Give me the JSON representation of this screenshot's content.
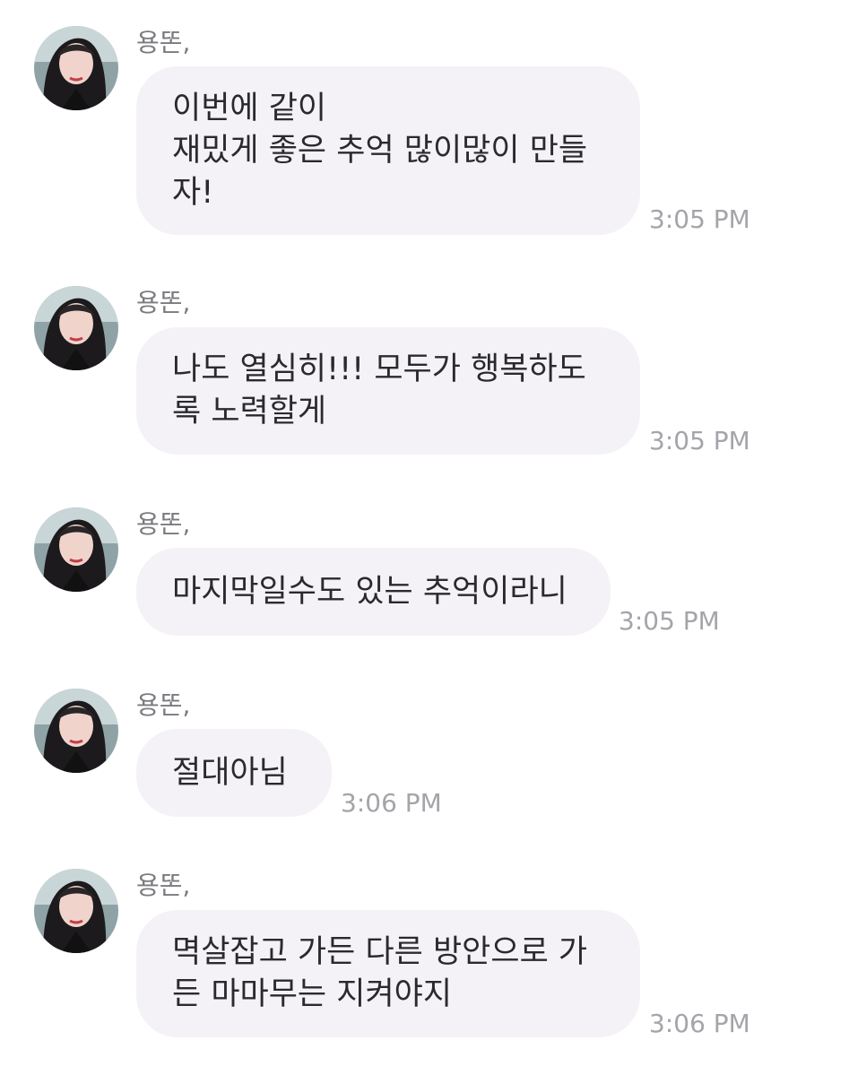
{
  "messages": [
    {
      "sender": "용똔,",
      "lines": [
        "이번에 같이",
        "재밌게 좋은 추억 많이많이 만들",
        "자!"
      ],
      "time": "3:05 PM"
    },
    {
      "sender": "용똔,",
      "lines": [
        "나도 열심히!!! 모두가 행복하도",
        "록 노력할게"
      ],
      "time": "3:05 PM"
    },
    {
      "sender": "용똔,",
      "lines": [
        "마지막일수도 있는 추억이라니"
      ],
      "time": "3:05 PM"
    },
    {
      "sender": "용똔,",
      "lines": [
        "절대아님"
      ],
      "time": "3:06 PM"
    },
    {
      "sender": "용똔,",
      "lines": [
        "멱살잡고 가든 다른 방안으로 가",
        "든 마마무는 지켜야지"
      ],
      "time": "3:06 PM"
    }
  ]
}
